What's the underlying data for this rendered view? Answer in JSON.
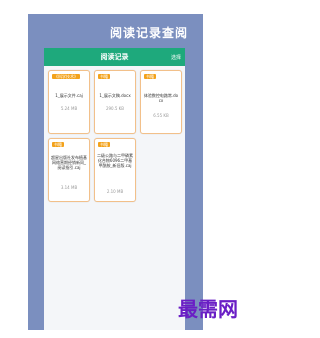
{
  "header": {
    "title": "阅读记录查阅"
  },
  "panel": {
    "title": "阅读记录",
    "action_label": "选择"
  },
  "cards": [
    {
      "tag": "《科学技术》",
      "title": "1_展示文件.caj",
      "size": "5.24 MB"
    },
    {
      "tag": "书籍",
      "title": "1_展示文稿.docx",
      "size": "290.5 KB"
    },
    {
      "tag": "书籍",
      "title": "体验数控电路常.docx",
      "size": "6.55 KB"
    },
    {
      "tag": "书籍",
      "title": "超星出版社发布植基网络营期经销新同_阅读指引.caj",
      "size": "3.14 MB"
    },
    {
      "tag": "书籍",
      "title": "二级公路与二甲磷素化合物6096二甲基甲酰胺_新旧版.caj",
      "size": "2.10 MB"
    }
  ],
  "watermark": {
    "text": "最需网"
  },
  "colors": {
    "accent": "#1ea97c",
    "tag": "#f3a21b",
    "background": "#7b8fbf",
    "card_border": "#f2c08a"
  }
}
